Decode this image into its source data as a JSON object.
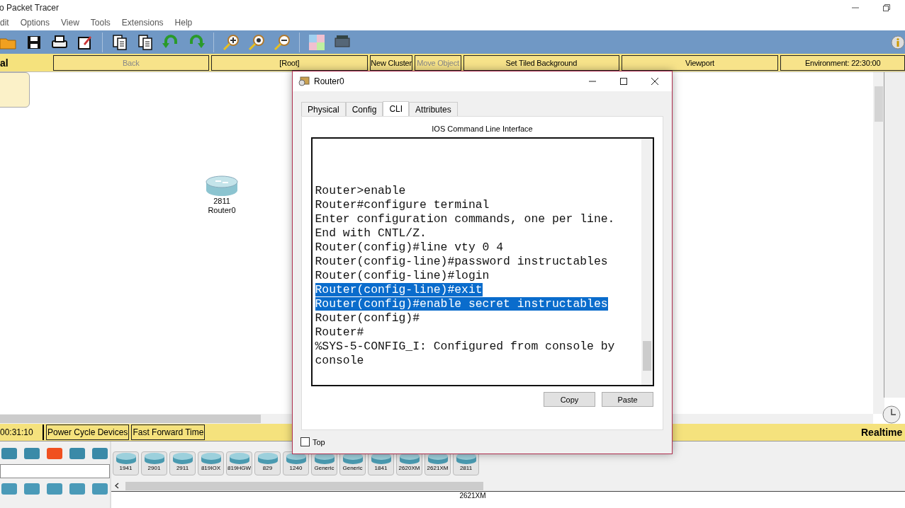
{
  "window": {
    "title": "o Packet Tracer"
  },
  "menu": [
    "dit",
    "Options",
    "View",
    "Tools",
    "Extensions",
    "Help"
  ],
  "nav_bar": {
    "mode_label": "al",
    "buttons": [
      {
        "label": "Back",
        "disabled": true
      },
      {
        "label": "[Root]",
        "disabled": false
      },
      {
        "label": "New Cluster",
        "disabled": false
      },
      {
        "label": "Move Object",
        "disabled": true
      },
      {
        "label": "Set Tiled Background",
        "disabled": false
      },
      {
        "label": "Viewport",
        "disabled": false
      },
      {
        "label": "Environment: 22:30:00",
        "disabled": false
      }
    ]
  },
  "canvas": {
    "devices": [
      {
        "model": "2811",
        "name": "Router0"
      }
    ]
  },
  "time_bar": {
    "clock": "00:31:10",
    "buttons": [
      "Power Cycle Devices",
      "Fast Forward Time"
    ],
    "mode": "Realtime"
  },
  "device_list": [
    "1941",
    "2901",
    "2911",
    "819IOX",
    "819HGW",
    "829",
    "1240",
    "Generic",
    "Generic",
    "1841",
    "2620XM",
    "2621XM",
    "2811"
  ],
  "status": "2621XM",
  "dialog": {
    "title": "Router0",
    "tabs": [
      {
        "label": "Physical",
        "selected": false
      },
      {
        "label": "Config",
        "selected": false
      },
      {
        "label": "CLI",
        "selected": true
      },
      {
        "label": "Attributes",
        "selected": false
      }
    ],
    "heading": "IOS Command Line Interface",
    "terminal_lines": [
      {
        "text": "Router>enable",
        "selected": false
      },
      {
        "text": "Router#configure terminal",
        "selected": false
      },
      {
        "text": "Enter configuration commands, one per line.",
        "selected": false
      },
      {
        "text": "End with CNTL/Z.",
        "selected": false
      },
      {
        "text": "Router(config)#line vty 0 4",
        "selected": false
      },
      {
        "text": "Router(config-line)#password instructables",
        "selected": false
      },
      {
        "text": "Router(config-line)#login",
        "selected": false
      },
      {
        "text": "Router(config-line)#exit",
        "selected": true
      },
      {
        "text": "Router(config)#enable secret instructables",
        "selected": true
      },
      {
        "text": "Router(config)#",
        "selected": false
      },
      {
        "text": "Router#",
        "selected": false
      },
      {
        "text": "%SYS-5-CONFIG_I: Configured from console by",
        "selected": false
      },
      {
        "text": "console",
        "selected": false
      }
    ],
    "buttons": [
      "Copy",
      "Paste"
    ],
    "top_checkbox": {
      "label": "Top",
      "checked": false
    }
  }
}
